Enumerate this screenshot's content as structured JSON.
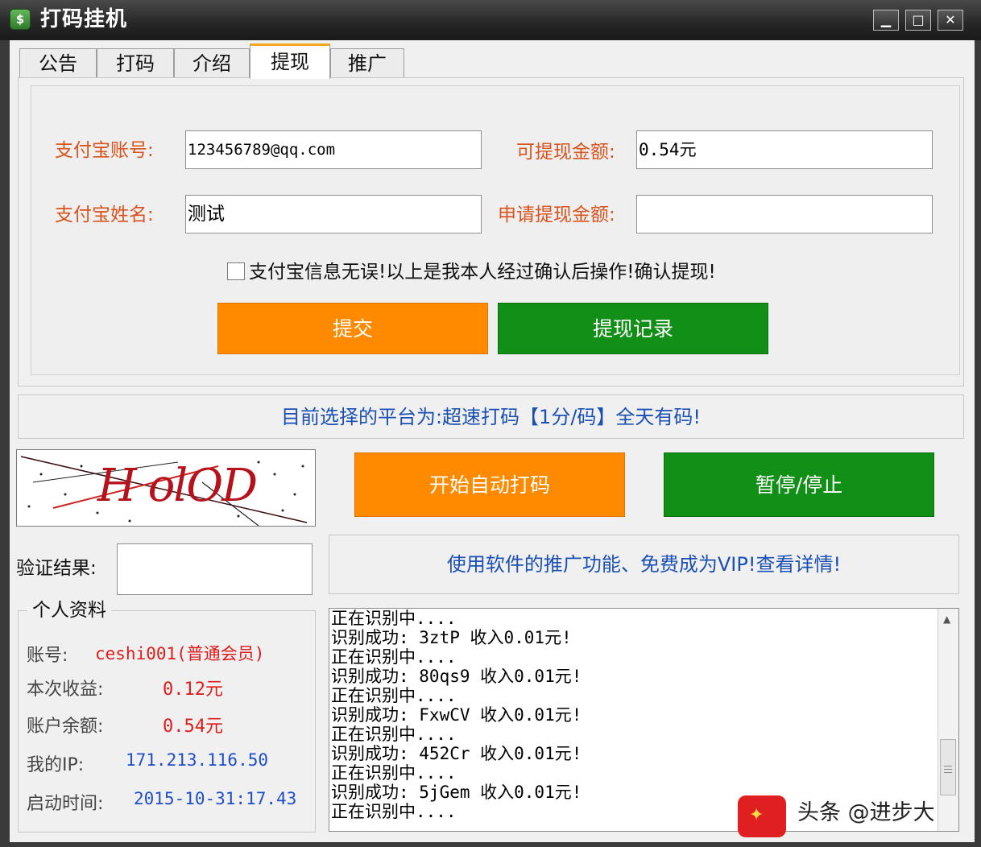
{
  "window": {
    "title": "打码挂机",
    "app_icon_glyph": "$",
    "controls": {
      "minimize": "▁",
      "maximize": "□",
      "close": "✕"
    }
  },
  "tabs": [
    "公告",
    "打码",
    "介绍",
    "提现",
    "推广"
  ],
  "active_tab": "提现",
  "withdraw": {
    "alipay_account_label": "支付宝账号:",
    "alipay_account_value": "123456789@qq.com",
    "alipay_name_label": "支付宝姓名:",
    "alipay_name_value": "测试",
    "available_label": "可提现金额:",
    "available_value": "0.54元",
    "apply_label": "申请提现金额:",
    "apply_value": "",
    "confirm_text": "支付宝信息无误!以上是我本人经过确认后操作!确认提现!",
    "confirm_checked": false,
    "submit_button": "提交",
    "records_button": "提现记录"
  },
  "platform_notice": "目前选择的平台为:超速打码【1分/码】全天有码!",
  "captcha": {
    "text": "H olOD"
  },
  "actions": {
    "start_button": "开始自动打码",
    "stop_button": "暂停/停止"
  },
  "verify": {
    "label": "验证结果:",
    "value": ""
  },
  "promo_link": "使用软件的推广功能、免费成为VIP!查看详情!",
  "profile": {
    "title": "个人资料",
    "account_label": "账号:",
    "account_value": "ceshi001(普通会员)",
    "session_income_label": "本次收益:",
    "session_income_value": "0.12元",
    "balance_label": "账户余额:",
    "balance_value": "0.54元",
    "ip_label": "我的IP:",
    "ip_value": "171.213.116.50",
    "start_time_label": "启动时间:",
    "start_time_value": "2015-10-31:17.43"
  },
  "log": [
    "正在识别中....",
    "识别成功: 3ztP 收入0.01元!",
    "正在识别中....",
    "识别成功: 80qs9 收入0.01元!",
    "正在识别中....",
    "识别成功: FxwCV 收入0.01元!",
    "正在识别中....",
    "识别成功: 452Cr 收入0.01元!",
    "正在识别中....",
    "识别成功: 5jGem 收入0.01元!",
    "正在识别中...."
  ],
  "colors": {
    "label_red": "#d9531e",
    "orange_button": "#ff8a00",
    "green_button": "#118f16",
    "link_blue": "#1a4fb3",
    "value_red": "#e01b1b"
  },
  "watermark": {
    "text": "头条 @进步大"
  }
}
